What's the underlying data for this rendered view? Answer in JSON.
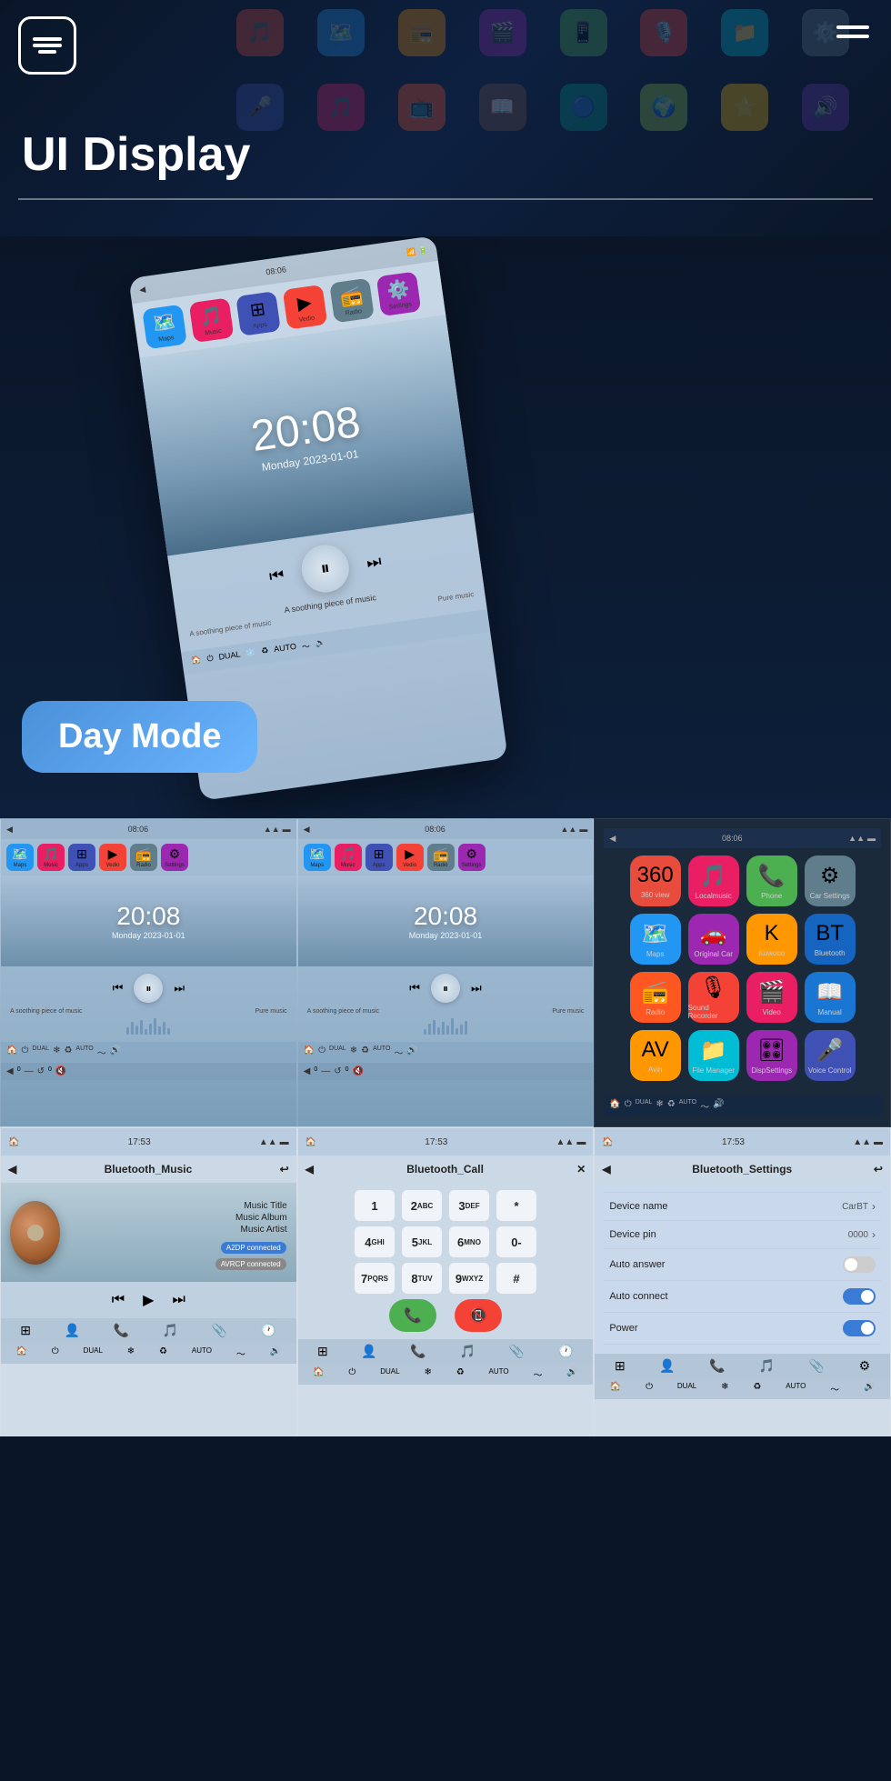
{
  "header": {
    "title": "UI Display",
    "logo_alt": "Menu icon",
    "hamburger_alt": "Navigation menu"
  },
  "day_mode": {
    "label": "Day Mode"
  },
  "main_phone": {
    "time": "20:08",
    "date": "Monday  2023-01-01",
    "music_text": "A soothing piece of music",
    "music_label2": "Pure music",
    "nav_apps": [
      "Maps",
      "Music",
      "Apps",
      "Vedio",
      "Radio",
      "Settings"
    ]
  },
  "row1": {
    "card1": {
      "status_time": "08:06",
      "time": "20:08",
      "date": "Monday  2023-01-01",
      "music_text": "A soothing piece of music",
      "music_label2": "Pure music"
    },
    "card2": {
      "status_time": "08:06",
      "time": "20:08",
      "date": "Monday  2023-01-01",
      "music_text": "A soothing piece of music",
      "music_label2": "Pure music"
    },
    "card3": {
      "status_time": "08:06",
      "apps": [
        {
          "label": "360 view",
          "color": "#e74c3c"
        },
        {
          "label": "Localmusic",
          "color": "#e91e63"
        },
        {
          "label": "Phone",
          "color": "#4caf50"
        },
        {
          "label": "Car Settings",
          "color": "#607d8b"
        },
        {
          "label": "Maps",
          "color": "#2196f3"
        },
        {
          "label": "Original Car",
          "color": "#9c27b0"
        },
        {
          "label": "Kuwooo",
          "color": "#ff9800"
        },
        {
          "label": "Bluetooth",
          "color": "#1565c0"
        },
        {
          "label": "Radio",
          "color": "#ff5722"
        },
        {
          "label": "Sound Recorder",
          "color": "#f44336"
        },
        {
          "label": "Video",
          "color": "#e91e63"
        },
        {
          "label": "Manual",
          "color": "#1976d2"
        },
        {
          "label": "Avin",
          "color": "#ff9800"
        },
        {
          "label": "File Manager",
          "color": "#00bcd4"
        },
        {
          "label": "DispSettings",
          "color": "#9c27b0"
        },
        {
          "label": "Voice Control",
          "color": "#3f51b5"
        }
      ]
    }
  },
  "row2": {
    "card1": {
      "status_time": "17:53",
      "title": "Bluetooth_Music",
      "music_title": "Music Title",
      "music_album": "Music Album",
      "music_artist": "Music Artist",
      "badge1": "A2DP connected",
      "badge2": "AVRCP connected"
    },
    "card2": {
      "status_time": "17:53",
      "title": "Bluetooth_Call",
      "dial_keys": [
        "1",
        "2ABC",
        "3DEF",
        "*",
        "4GHI",
        "5JKL",
        "6MNO",
        "0-",
        "7PQRS",
        "8TUV",
        "9WXYZ",
        "#"
      ]
    },
    "card3": {
      "status_time": "17:53",
      "title": "Bluetooth_Settings",
      "settings": [
        {
          "label": "Device name",
          "value": "CarBT",
          "type": "arrow"
        },
        {
          "label": "Device pin",
          "value": "0000",
          "type": "arrow"
        },
        {
          "label": "Auto answer",
          "value": "",
          "type": "toggle",
          "state": "off"
        },
        {
          "label": "Auto connect",
          "value": "",
          "type": "toggle",
          "state": "on"
        },
        {
          "label": "Power",
          "value": "",
          "type": "toggle",
          "state": "on"
        }
      ]
    }
  },
  "colors": {
    "bg_dark": "#0a1628",
    "accent_blue": "#3a7bd5",
    "accent_light": "#6bb5ff"
  }
}
